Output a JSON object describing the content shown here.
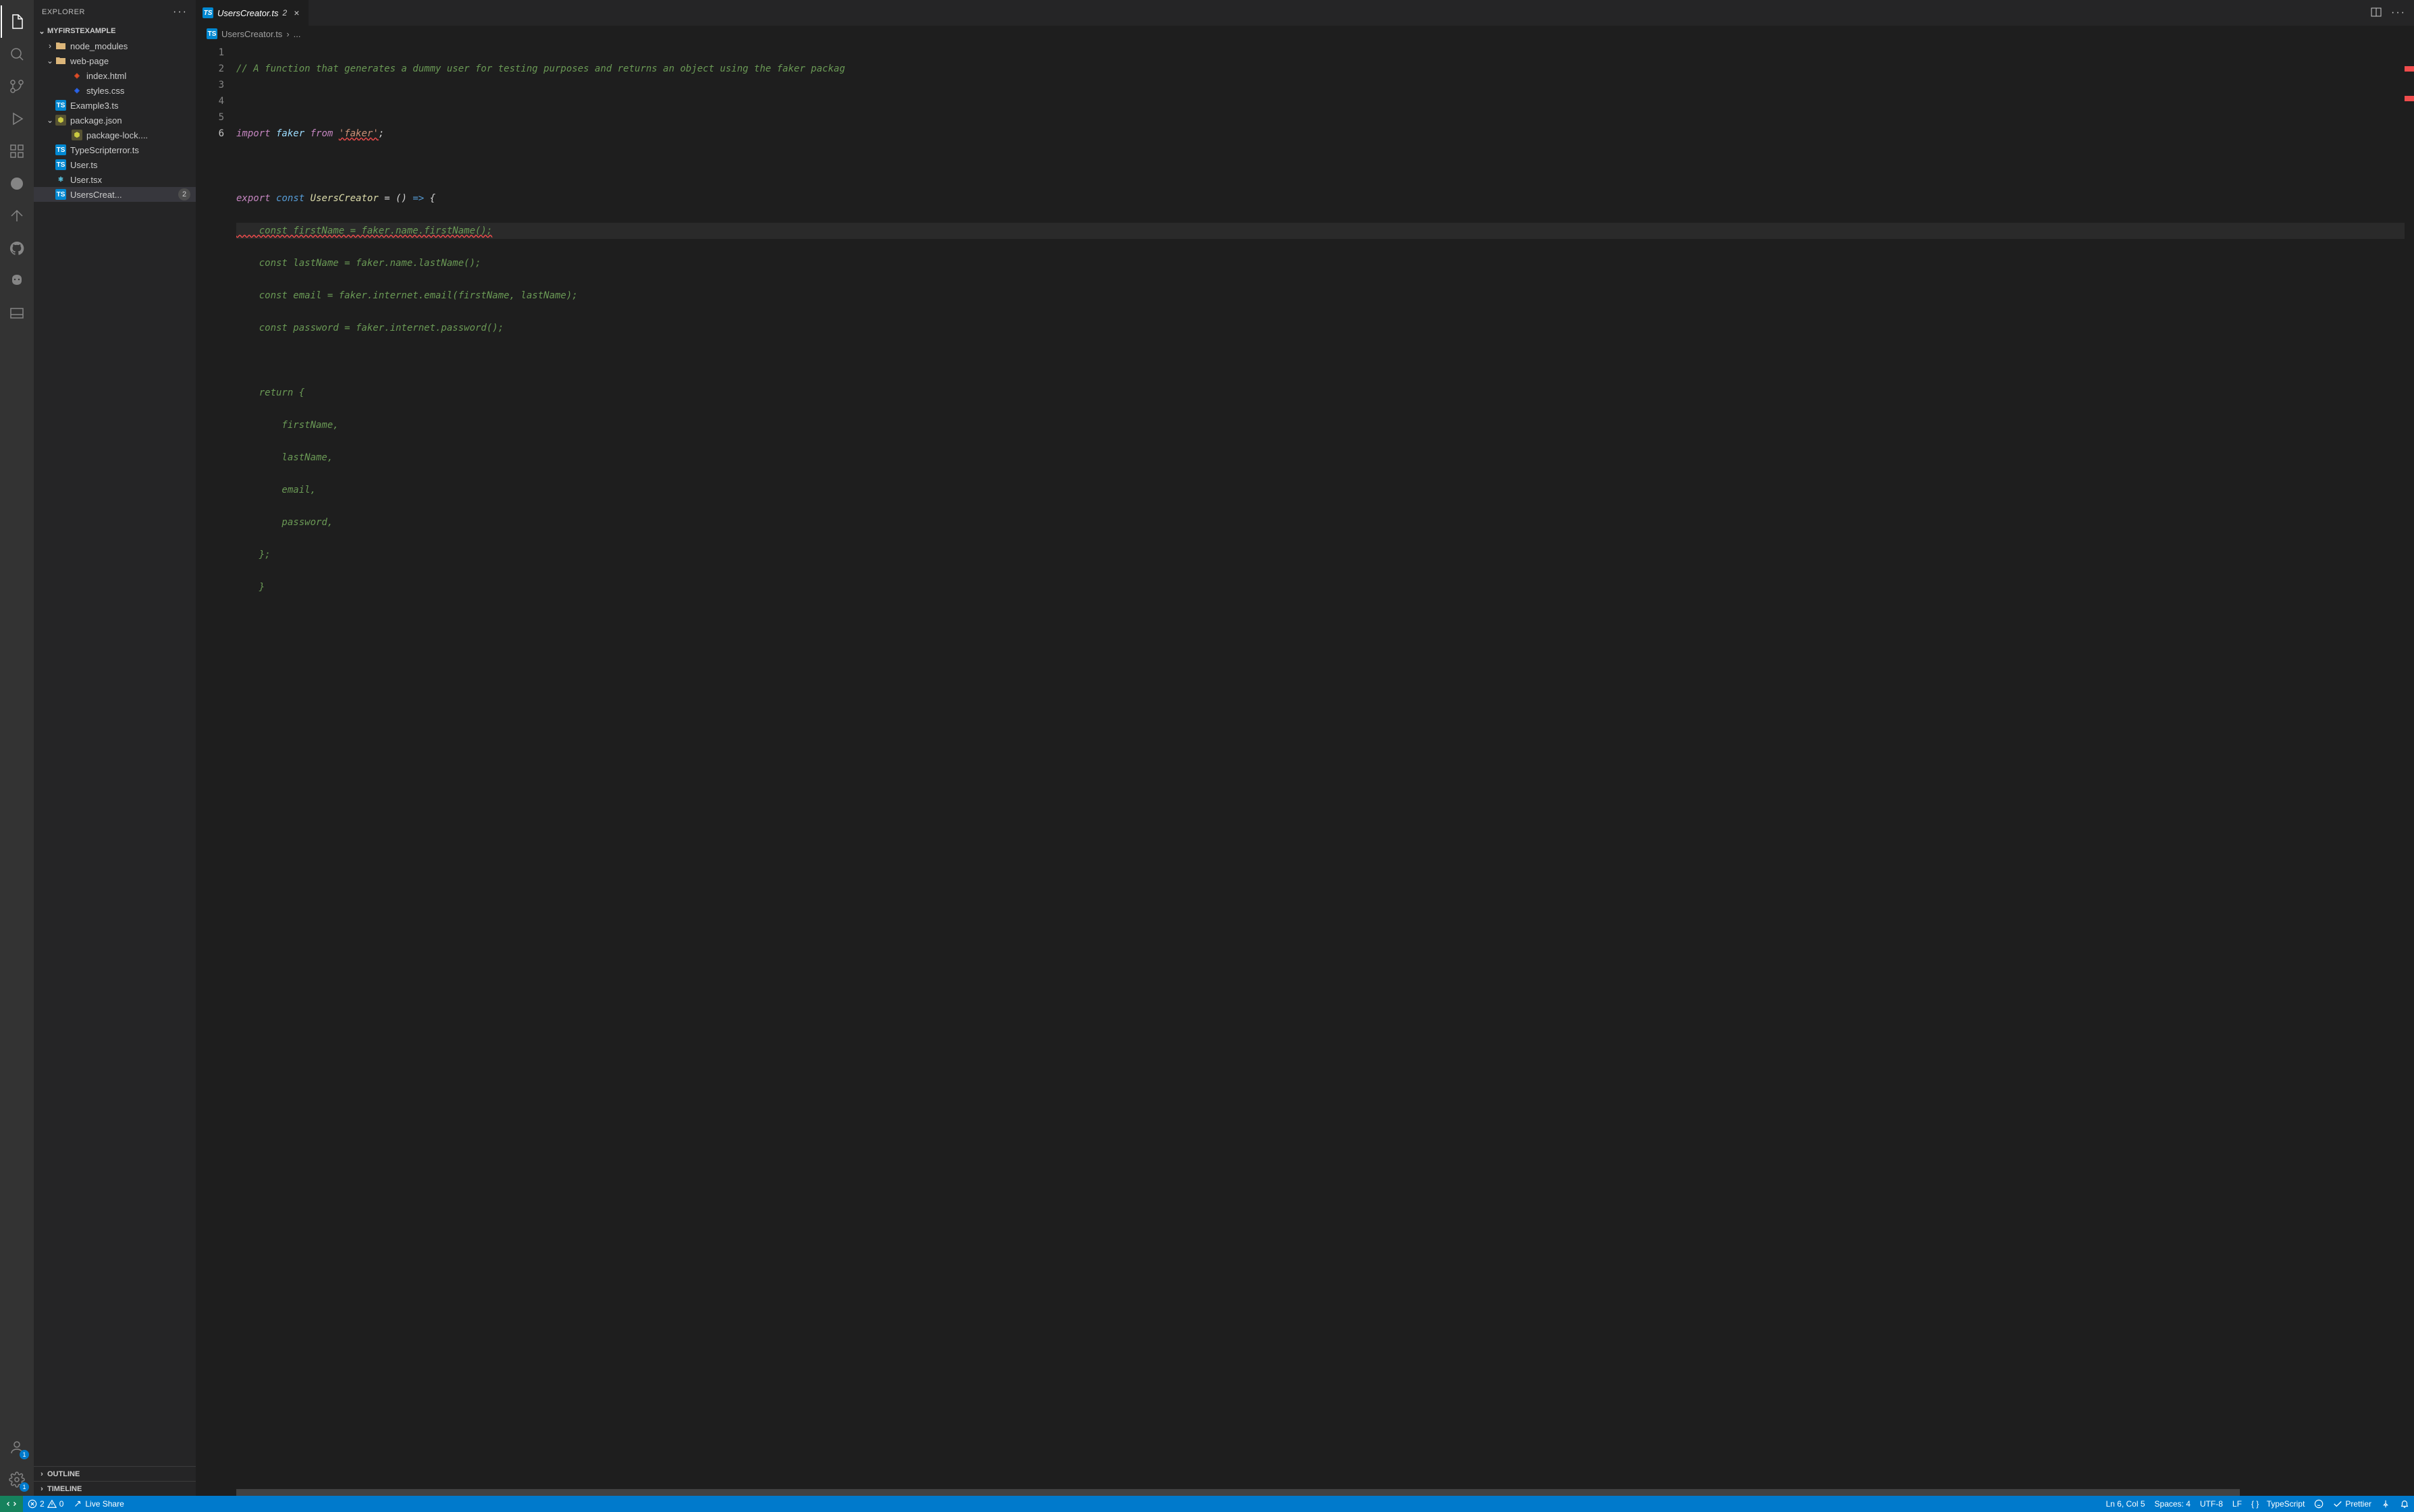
{
  "sidebar": {
    "title": "EXPLORER",
    "project": "MYFIRSTEXAMPLE",
    "outline": "OUTLINE",
    "timeline": "TIMELINE",
    "tree": {
      "node_modules": "node_modules",
      "web_page": "web-page",
      "index_html": "index.html",
      "styles_css": "styles.css",
      "example3": "Example3.ts",
      "package_json": "package.json",
      "package_lock": "package-lock....",
      "ts_error": "TypeScripterror.ts",
      "user_ts": "User.ts",
      "user_tsx": "User.tsx",
      "users_creator": "UsersCreat...",
      "users_creator_count": "2"
    }
  },
  "activity_badges": {
    "accounts": "1",
    "settings": "1"
  },
  "tab": {
    "label": "UsersCreator.ts",
    "count": "2",
    "breadcrumb_file": "UsersCreator.ts",
    "breadcrumb_rest": "..."
  },
  "code": {
    "l1_a": "// A function that generates a dummy user for testing purposes and returns an object using the faker packag",
    "l3_import": "import",
    "l3_faker": " faker ",
    "l3_from": "from",
    "l3_str": "'faker'",
    "l3_semi": ";",
    "l5_export": "export",
    "l5_const": "const",
    "l5_name": "UsersCreator",
    "l5_eq": " = () ",
    "l5_arrow": "=>",
    "l5_brace": " {",
    "l6": "    const firstName = faker.name.firstName();",
    "l7": "    const lastName = faker.name.lastName();",
    "l8": "    const email = faker.internet.email(firstName, lastName);",
    "l9": "    const password = faker.internet.password();",
    "l11": "    return {",
    "l12": "        firstName,",
    "l13": "        lastName,",
    "l14": "        email,",
    "l15": "        password,",
    "l16": "    };",
    "l17": "    }"
  },
  "gutter": [
    "1",
    "2",
    "3",
    "4",
    "5",
    "6"
  ],
  "status": {
    "errors": "2",
    "warnings": "0",
    "live_share": "Live Share",
    "ln_col": "Ln 6, Col 5",
    "spaces": "Spaces: 4",
    "encoding": "UTF-8",
    "eol": "LF",
    "lang": "TypeScript",
    "prettier": "Prettier"
  }
}
